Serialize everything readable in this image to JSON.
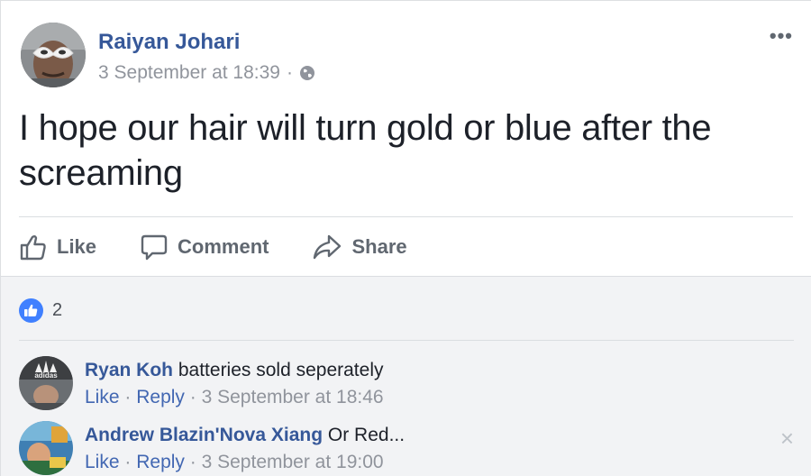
{
  "post": {
    "author": "Raiyan Johari",
    "timestamp": "3 September at 18:39",
    "separator": "·",
    "privacy_icon": "globe-icon",
    "more_label": "•••",
    "text": "I hope our hair will turn gold or blue after the screaming"
  },
  "actions": {
    "like_label": "Like",
    "comment_label": "Comment",
    "share_label": "Share"
  },
  "reactions": {
    "icon": "thumbs-up-icon",
    "count": "2"
  },
  "comments": [
    {
      "author": "Ryan Koh",
      "text": "batteries sold seperately",
      "like_label": "Like",
      "dot1": "·",
      "reply_label": "Reply",
      "dot2": "·",
      "timestamp": "3 September at 18:46",
      "avatar_text": "adidas"
    },
    {
      "author": "Andrew Blazin'Nova Xiang",
      "text": "Or Red...",
      "like_label": "Like",
      "dot1": "·",
      "reply_label": "Reply",
      "dot2": "·",
      "timestamp": "3 September at 19:00",
      "close_label": "×"
    }
  ],
  "colors": {
    "link": "#365899",
    "meta": "#90949c",
    "like_badge": "#4080ff",
    "comments_bg": "#f2f3f5"
  }
}
